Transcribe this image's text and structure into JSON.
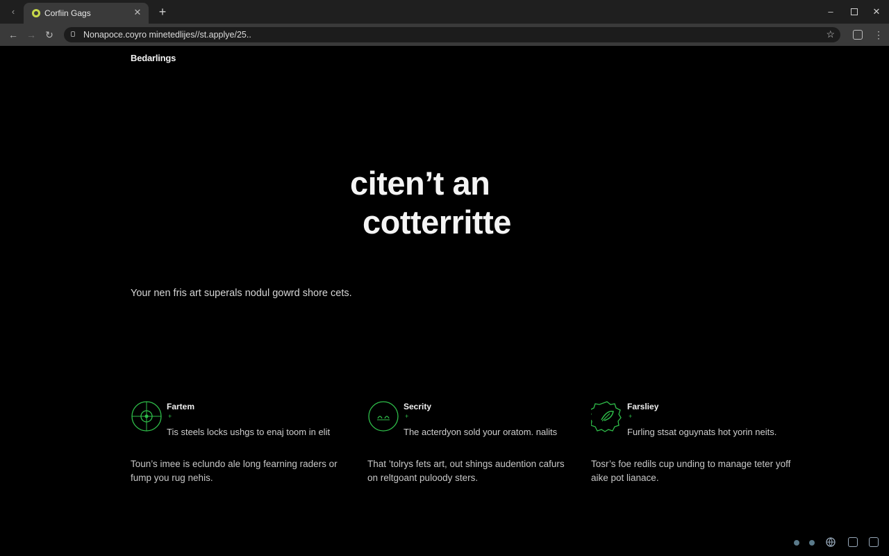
{
  "browser": {
    "tab_title": "Corfiin Gags",
    "url": "Nonapoce.coyro minetedlijes//st.applye/25..",
    "icons": {
      "scroll": "chevron-left-icon",
      "close": "close-icon",
      "new_tab": "plus-icon",
      "back": "back-arrow-icon",
      "forward": "forward-arrow-icon",
      "reload": "reload-icon",
      "bookmark": "star-icon"
    }
  },
  "page": {
    "brand": "Bedarlings",
    "hero_line1": "citen’t an",
    "hero_line2": "cotterritte",
    "subtitle": "Your nen fris art superals nodul gowrd shore cets.",
    "features": [
      {
        "name": "Fartem",
        "mark": "+",
        "description": "Tis steels locks ushgs to enaj toom in elit",
        "body": "Toun’s imee is eclundo ale long fearning raders or fump you rug nehis.",
        "icon": "target-icon"
      },
      {
        "name": "Secrity",
        "mark": "+",
        "description": "The acterdyon sold your oratom. nalits",
        "body": "That ’tolrys fets art, out shings audention cafurs on reltgoant puloody sters.",
        "icon": "shield-face-icon"
      },
      {
        "name": "Farsliey",
        "mark": "+",
        "description": "Furling stsat oguynats hot yorin neits.",
        "body": "Tosr’s foe redils cup unding to manage teter yoff aike pot lianace.",
        "icon": "leaf-badge-icon"
      }
    ],
    "accent_color": "#2fbf4a"
  }
}
